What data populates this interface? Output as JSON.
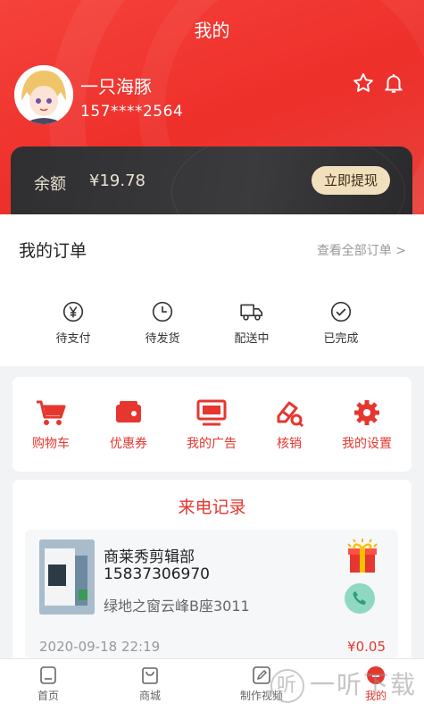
{
  "header": {
    "title": "我的",
    "username": "一只海豚",
    "phone": "157****2564"
  },
  "balance": {
    "label": "余额",
    "value": "¥19.78",
    "withdraw_label": "立即提现"
  },
  "orders": {
    "title": "我的订单",
    "view_all": "查看全部订单 >",
    "items": [
      {
        "label": "待支付",
        "icon": "yen-circle-icon"
      },
      {
        "label": "待发货",
        "icon": "clock-icon"
      },
      {
        "label": "配送中",
        "icon": "truck-icon"
      },
      {
        "label": "已完成",
        "icon": "check-circle-icon"
      }
    ]
  },
  "tools": {
    "items": [
      {
        "label": "购物车",
        "icon": "cart-icon"
      },
      {
        "label": "优惠券",
        "icon": "coupon-icon"
      },
      {
        "label": "我的广告",
        "icon": "monitor-icon"
      },
      {
        "label": "核销",
        "icon": "verify-icon"
      },
      {
        "label": "我的设置",
        "icon": "gear-icon"
      }
    ]
  },
  "calls": {
    "title": "来电记录",
    "record": {
      "name": "商莱秀剪辑部",
      "phone": "15837306970",
      "address": "绿地之窗云峰B座3011",
      "date": "2020-09-18  22:19",
      "amount": "¥0.05"
    }
  },
  "tabbar": {
    "items": [
      {
        "label": "首页",
        "icon": "home-icon"
      },
      {
        "label": "商城",
        "icon": "shop-bag-icon"
      },
      {
        "label": "制作视频",
        "icon": "edit-icon"
      },
      {
        "label": "我的",
        "icon": "profile-icon"
      }
    ],
    "active_index": 3
  },
  "watermark": {
    "badge": "听",
    "text": "一听下载"
  },
  "colors": {
    "accent": "#e5372f",
    "header": "#ef3a33",
    "card_dark": "#333335",
    "withdraw_button": "#f1dfbd"
  }
}
